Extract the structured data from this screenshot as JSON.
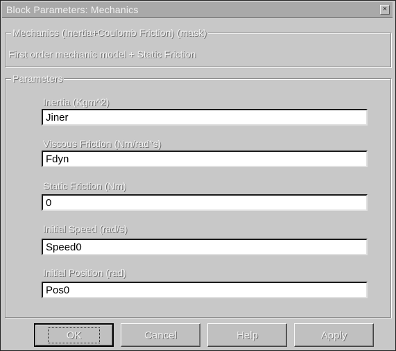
{
  "window": {
    "title": "Block Parameters: Mechanics",
    "close_glyph": "×"
  },
  "mask": {
    "group_title": "Mechanics (Inertia+Coulomb Friction) (mask)",
    "description": "First order mechanic model + Static Friction"
  },
  "parameters": {
    "group_title": "Parameters",
    "fields": [
      {
        "label": "Inertia (Kgm^2)",
        "value": "Jiner"
      },
      {
        "label": "Viscous Friction (Nm/rad*s)",
        "value": "Fdyn"
      },
      {
        "label": "Static Friction (Nm)",
        "value": "0"
      },
      {
        "label": "Initial Speed (rad/s)",
        "value": "Speed0"
      },
      {
        "label": "Initial Position (rad)",
        "value": "Pos0"
      }
    ]
  },
  "buttons": {
    "ok": "OK",
    "cancel": "Cancel",
    "help": "Help",
    "apply": "Apply"
  }
}
